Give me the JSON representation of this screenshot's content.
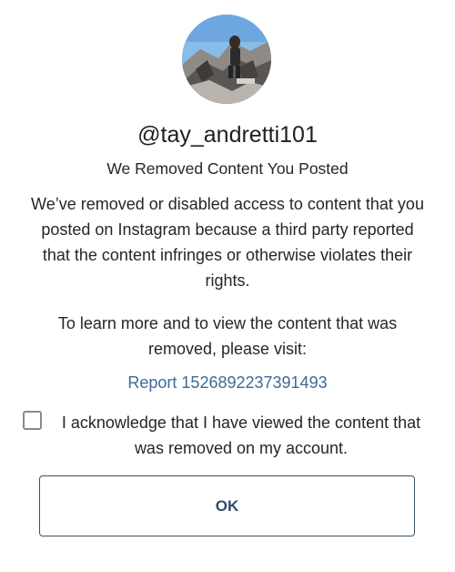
{
  "profile": {
    "avatar_icon": "profile-photo-icon",
    "username": "@tay_andretti101"
  },
  "notice": {
    "title": "We Removed Content You Posted",
    "paragraph1": "We’ve removed or disabled access to content that you posted on Instagram because a third party reported that the content infringes or otherwise violates their rights.",
    "paragraph2": "To learn more and to view the content that was removed, please visit:",
    "report_link": "Report 1526892237391493"
  },
  "acknowledge": {
    "checked": false,
    "label": "I acknowledge that I have viewed the content that was removed on my account."
  },
  "actions": {
    "ok_label": "OK"
  },
  "colors": {
    "link": "#3d6a96",
    "button_text": "#2f4b6b",
    "button_border": "#3d4f66",
    "text": "#262626"
  }
}
